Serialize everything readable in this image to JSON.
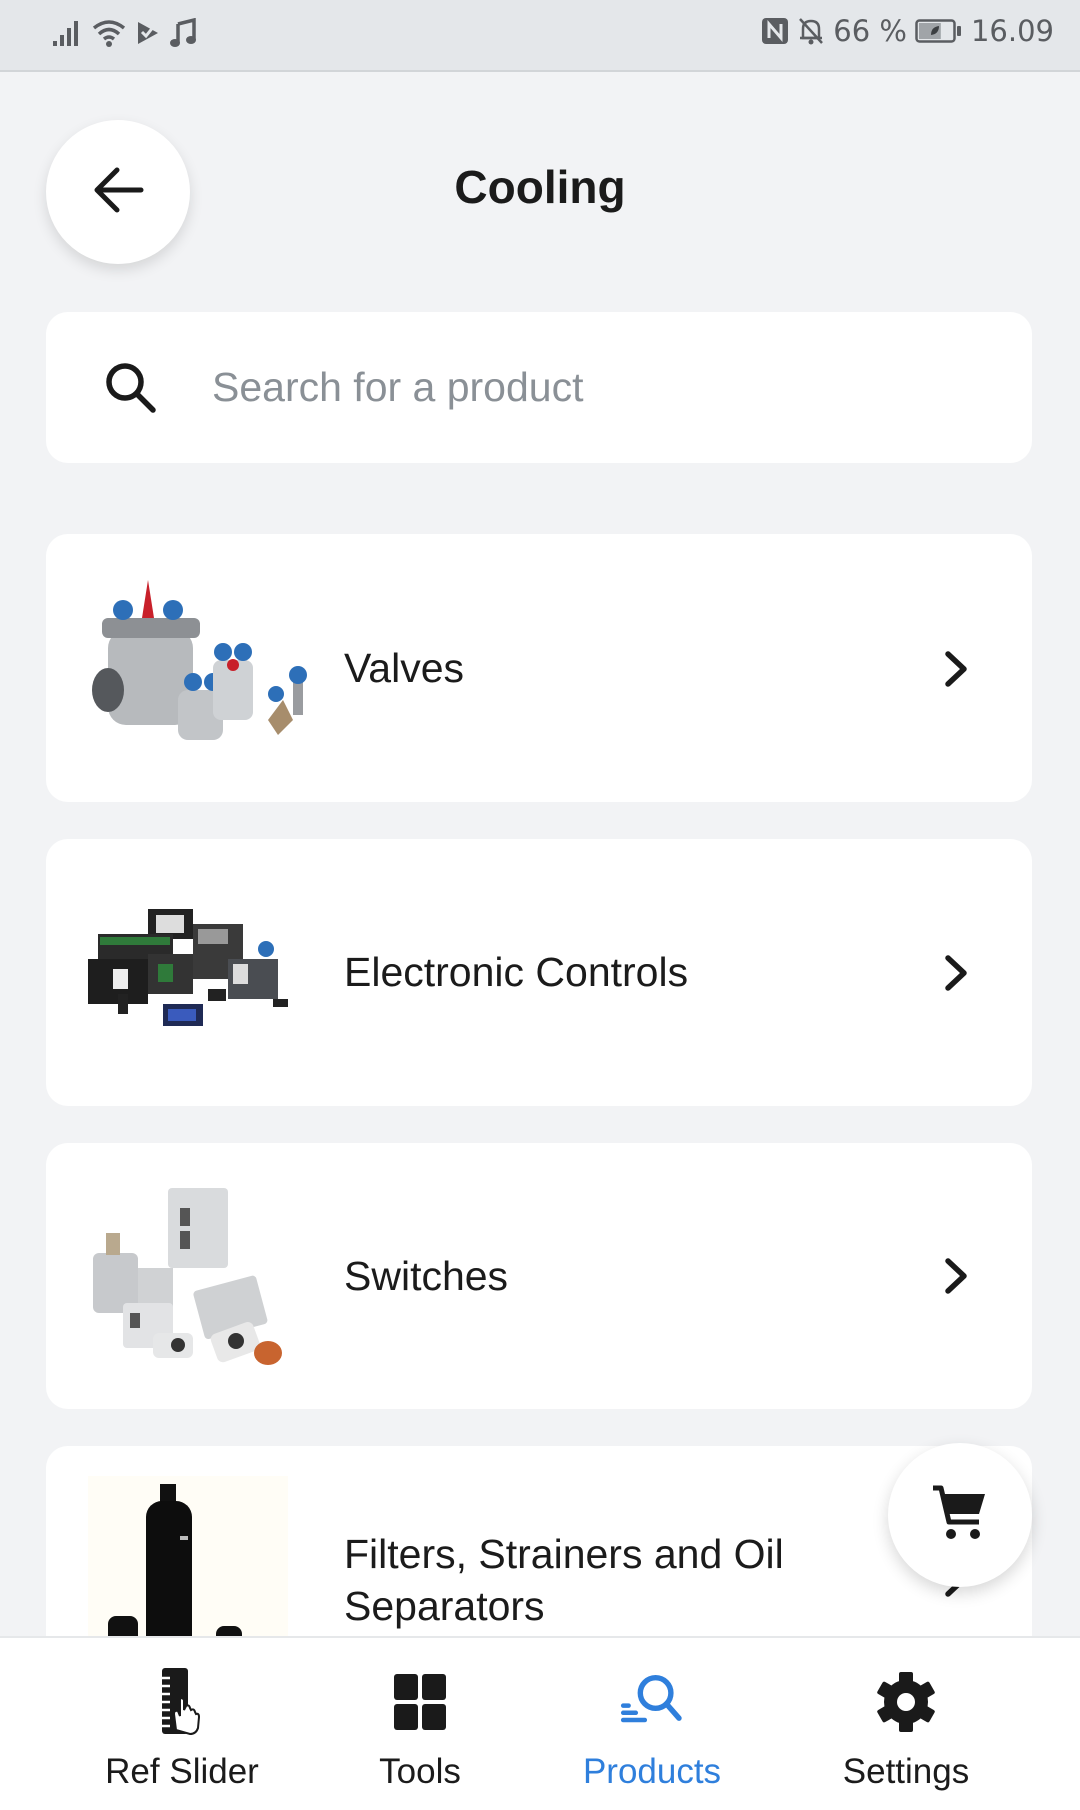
{
  "status_bar": {
    "left_icons": [
      "signal-icon",
      "wifi-icon",
      "play-store-icon",
      "music-note-icon"
    ],
    "right_icons": [
      "nfc-icon",
      "bell-off-icon",
      "battery-icon"
    ],
    "battery_percent": "66 %",
    "battery_level": 0.66,
    "time": "16.09"
  },
  "header": {
    "back_icon": "arrow-left-icon",
    "title": "Cooling"
  },
  "search": {
    "icon": "search-icon",
    "placeholder": "Search for a product",
    "value": ""
  },
  "categories": [
    {
      "label": "Valves",
      "image": "valves-product-image",
      "icon": "chevron-right-icon"
    },
    {
      "label": "Electronic Controls",
      "image": "electronic-controls-product-image",
      "icon": "chevron-right-icon"
    },
    {
      "label": "Switches",
      "image": "switches-product-image",
      "icon": "chevron-right-icon"
    },
    {
      "label": "Filters, Strainers and Oil Separators",
      "image": "filters-product-image",
      "icon": "chevron-right-icon"
    }
  ],
  "cart_fab": {
    "icon": "shopping-cart-icon"
  },
  "bottom_nav": {
    "active_color": "#2f7fdc",
    "items": [
      {
        "label": "Ref Slider",
        "icon": "ruler-hand-icon",
        "active": false
      },
      {
        "label": "Tools",
        "icon": "grid-icon",
        "active": false
      },
      {
        "label": "Products",
        "icon": "product-search-icon",
        "active": true
      },
      {
        "label": "Settings",
        "icon": "gear-icon",
        "active": false
      }
    ]
  }
}
